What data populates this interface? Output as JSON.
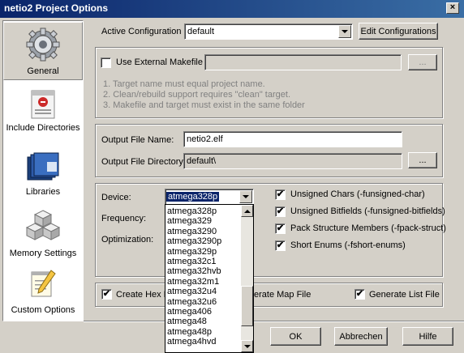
{
  "window": {
    "title": "netio2 Project Options",
    "close_glyph": "×"
  },
  "sidebar": {
    "items": [
      {
        "label": "General",
        "icon": "gear-icon",
        "selected": true
      },
      {
        "label": "Include Directories",
        "icon": "include-directories-icon"
      },
      {
        "label": "Libraries",
        "icon": "books-icon"
      },
      {
        "label": "Memory Settings",
        "icon": "memory-blocks-icon"
      },
      {
        "label": "Custom Options",
        "icon": "notepad-pencil-icon"
      }
    ]
  },
  "config": {
    "label": "Active Configuration",
    "value": "default",
    "edit_button": "Edit Configurations"
  },
  "makefile": {
    "checkbox_label": "Use External Makefile",
    "checked": false,
    "path_value": "",
    "browse_label": "...",
    "notes": [
      "1. Target name must equal project name.",
      "2. Clean/rebuild support requires \"clean\" target.",
      "3. Makefile and target must exist in the same folder"
    ]
  },
  "output": {
    "file_name_label": "Output File Name:",
    "file_name_value": "netio2.elf",
    "directory_label": "Output File Directory:",
    "directory_value": "default\\",
    "browse_label": "..."
  },
  "device": {
    "device_label": "Device:",
    "device_value": "atmega328p",
    "frequency_label": "Frequency:",
    "optimization_label": "Optimization:",
    "dropdown_options": [
      "atmega328p",
      "atmega329",
      "atmega3290",
      "atmega3290p",
      "atmega329p",
      "atmega32c1",
      "atmega32hvb",
      "atmega32m1",
      "atmega32u4",
      "atmega32u6",
      "atmega406",
      "atmega48",
      "atmega48p",
      "atmega4hvd"
    ]
  },
  "compiler_flags": [
    {
      "label": "Unsigned Chars (-funsigned-char)",
      "checked": true
    },
    {
      "label": "Unsigned Bitfields (-funsigned-bitfields)",
      "checked": true
    },
    {
      "label": "Pack Structure Members (-fpack-struct)",
      "checked": true
    },
    {
      "label": "Short Enums (-fshort-enums)",
      "checked": true
    }
  ],
  "generate": {
    "hex_label": "Create Hex F",
    "hex_checked": true,
    "map_label": "erate Map File",
    "list_label": "Generate List File",
    "list_checked": true
  },
  "buttons": {
    "ok": "OK",
    "cancel": "Abbrechen",
    "help": "Hilfe"
  },
  "colors": {
    "titlebar_start": "#0a246a",
    "titlebar_end": "#3a6ea5",
    "face": "#d4d0c8",
    "selection": "#0a246a"
  },
  "check_glyph": "✔"
}
